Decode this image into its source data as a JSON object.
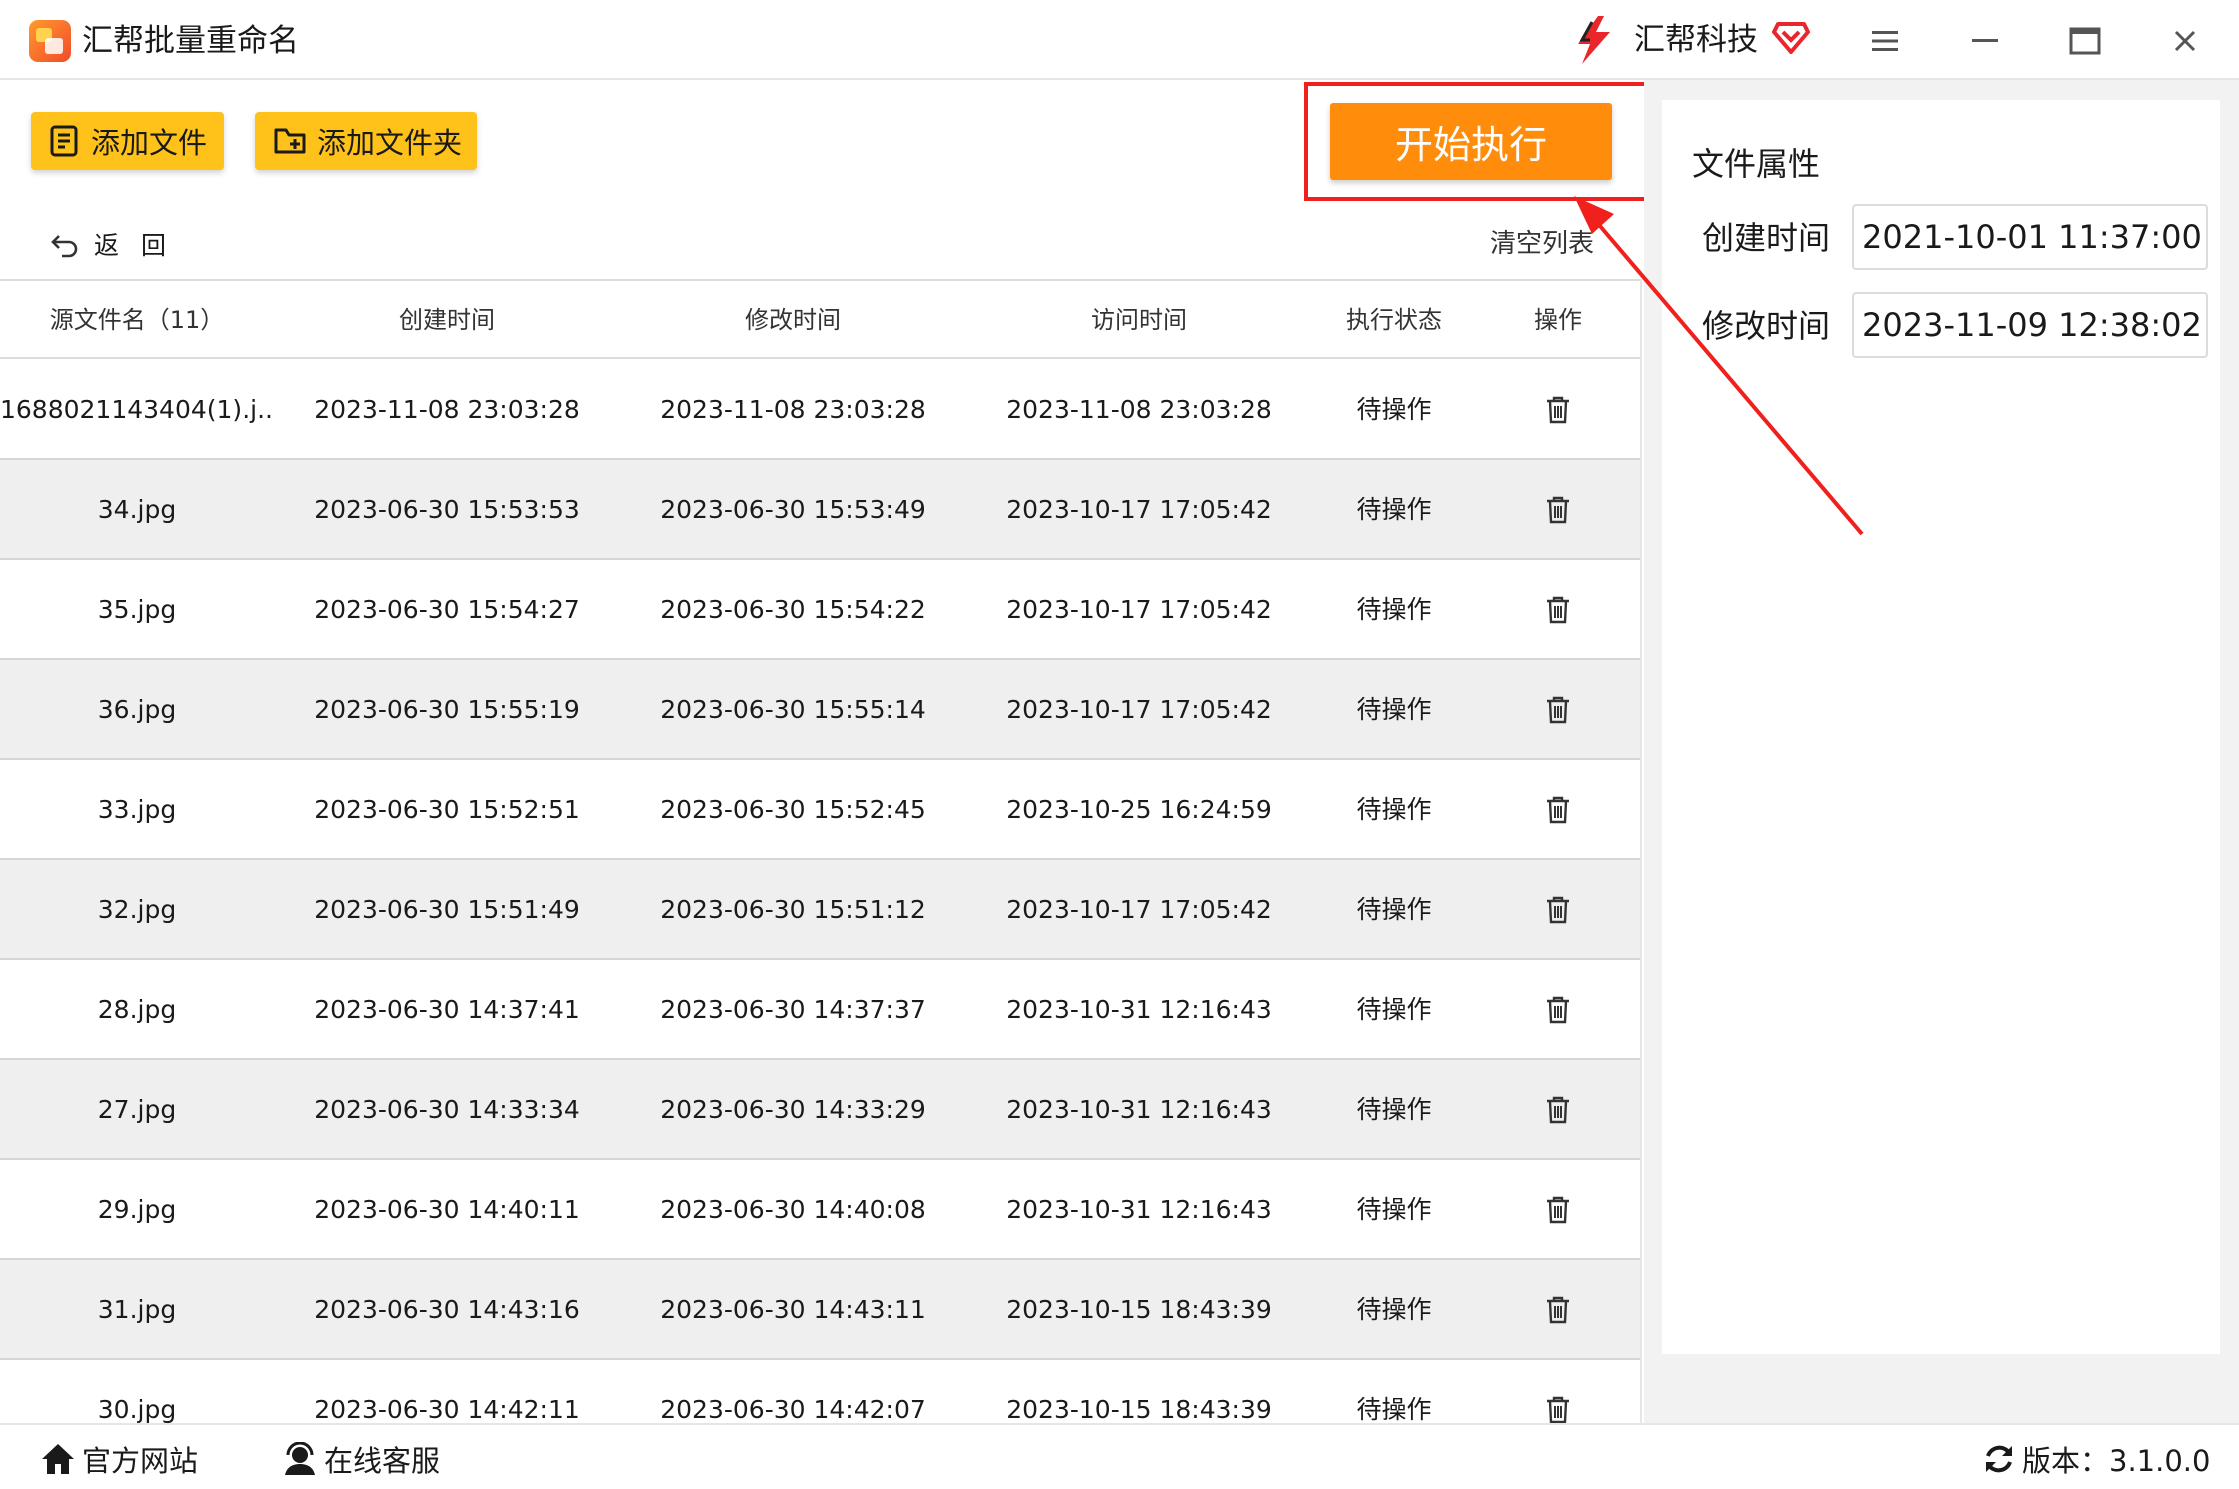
{
  "window": {
    "title": "汇帮批量重命名",
    "brand": "汇帮科技"
  },
  "toolbar": {
    "add_file": "添加文件",
    "add_folder": "添加文件夹",
    "start": "开始执行",
    "back": "返回",
    "clear_list": "清空列表"
  },
  "table": {
    "headers": [
      "源文件名（11）",
      "创建时间",
      "修改时间",
      "访问时间",
      "执行状态",
      "操作"
    ],
    "rows": [
      [
        "1688021143404(1).j...",
        "2023-11-08 23:03:28",
        "2023-11-08 23:03:28",
        "2023-11-08 23:03:28",
        "待操作"
      ],
      [
        "34.jpg",
        "2023-06-30 15:53:53",
        "2023-06-30 15:53:49",
        "2023-10-17 17:05:42",
        "待操作"
      ],
      [
        "35.jpg",
        "2023-06-30 15:54:27",
        "2023-06-30 15:54:22",
        "2023-10-17 17:05:42",
        "待操作"
      ],
      [
        "36.jpg",
        "2023-06-30 15:55:19",
        "2023-06-30 15:55:14",
        "2023-10-17 17:05:42",
        "待操作"
      ],
      [
        "33.jpg",
        "2023-06-30 15:52:51",
        "2023-06-30 15:52:45",
        "2023-10-25 16:24:59",
        "待操作"
      ],
      [
        "32.jpg",
        "2023-06-30 15:51:49",
        "2023-06-30 15:51:12",
        "2023-10-17 17:05:42",
        "待操作"
      ],
      [
        "28.jpg",
        "2023-06-30 14:37:41",
        "2023-06-30 14:37:37",
        "2023-10-31 12:16:43",
        "待操作"
      ],
      [
        "27.jpg",
        "2023-06-30 14:33:34",
        "2023-06-30 14:33:29",
        "2023-10-31 12:16:43",
        "待操作"
      ],
      [
        "29.jpg",
        "2023-06-30 14:40:11",
        "2023-06-30 14:40:08",
        "2023-10-31 12:16:43",
        "待操作"
      ],
      [
        "31.jpg",
        "2023-06-30 14:43:16",
        "2023-06-30 14:43:11",
        "2023-10-15 18:43:39",
        "待操作"
      ],
      [
        "30.jpg",
        "2023-06-30 14:42:11",
        "2023-06-30 14:42:07",
        "2023-10-15 18:43:39",
        "待操作"
      ]
    ]
  },
  "properties": {
    "title": "文件属性",
    "created_label": "创建时间",
    "created_value": "2021-10-01 11:37:00",
    "modified_label": "修改时间",
    "modified_value": "2023-11-09 12:38:02"
  },
  "status": {
    "website": "官方网站",
    "service": "在线客服",
    "version": "版本：3.1.0.0"
  },
  "colors": {
    "tool_button": "#ffc21a",
    "start_button": "#ff8c0a",
    "annotation_red": "#f0201c",
    "alt_row": "#efefef"
  },
  "icons": {
    "add_file": "document-list-icon",
    "add_folder": "folder-plus-icon",
    "back": "undo-arrow-icon",
    "row_action": "trash-icon",
    "website": "home-icon",
    "service": "headset-user-icon",
    "version": "refresh-icon"
  }
}
